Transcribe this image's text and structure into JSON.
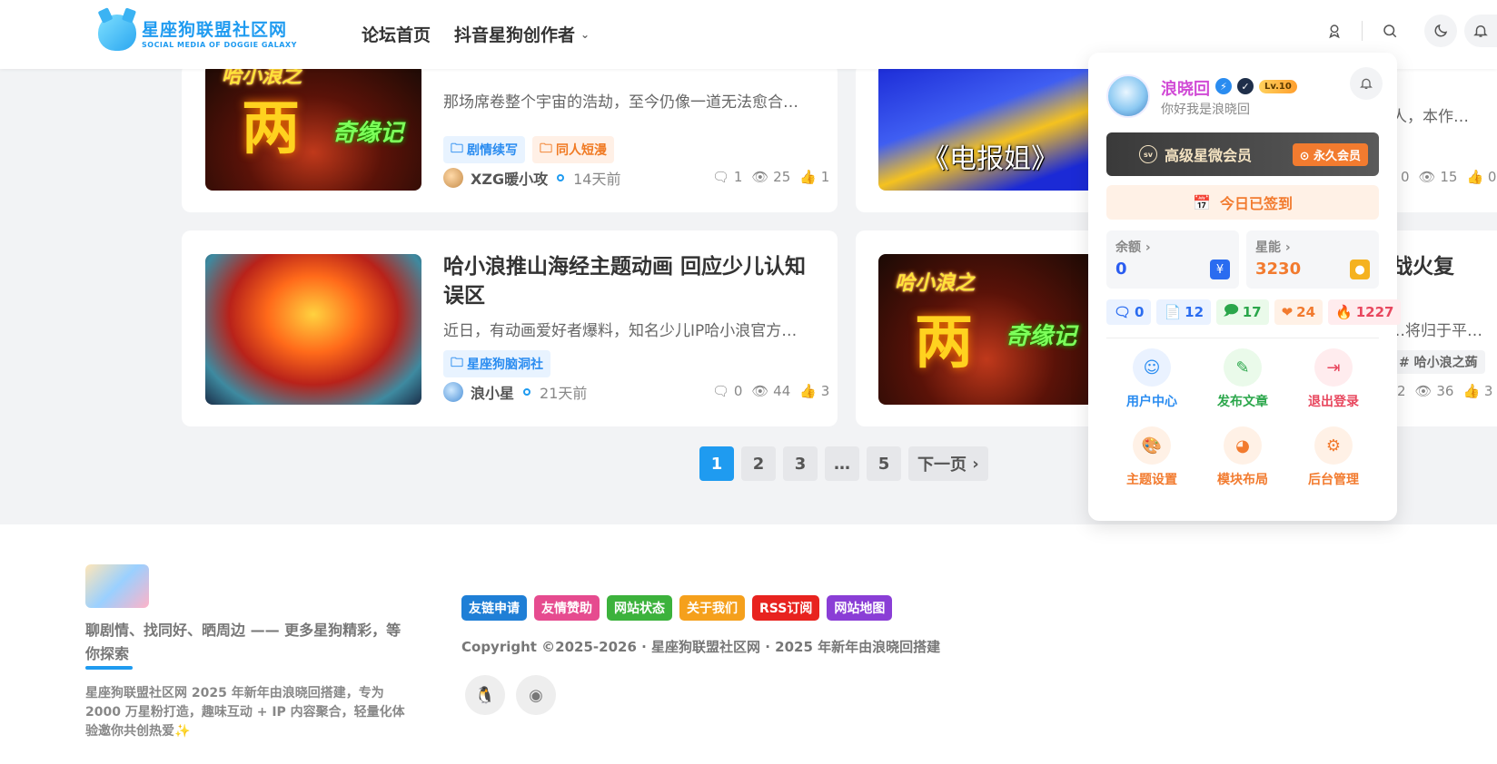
{
  "header": {
    "logo_title": "星座狗联盟社区网",
    "logo_sub": "SOCIAL MEDIA OF DOGGIE GALAXY",
    "nav": [
      {
        "label": "论坛首页"
      },
      {
        "label": "抖音星狗创作者"
      }
    ],
    "icons": [
      "user-icon",
      "search-icon",
      "moon-icon",
      "bell-icon"
    ]
  },
  "posts": [
    {
      "excerpt": "那场席卷整个宇宙的浩劫，至今仍像一道无法愈合…",
      "tags": [
        "剧情续写",
        "同人短漫"
      ],
      "author": "XZG暖小攻",
      "time": "14天前",
      "comments": "1",
      "views": "25",
      "likes": "1",
      "thumb_title": "哈小浪之",
      "thumb_big": "两",
      "thumb_side": "奇缘记"
    },
    {
      "thumb_caption": "《电报姐》",
      "excerpt": "人，本作品…",
      "comments": "0",
      "views": "15",
      "likes": "0"
    },
    {
      "title": "哈小浪推山海经主题动画 回应少儿认知误区",
      "excerpt": "近日，有动画爱好者爆料，知名少儿IP哈小浪官方…",
      "tags": [
        "星座狗脑洞社"
      ],
      "author": "浪小星",
      "time": "21天前",
      "comments": "0",
      "views": "44",
      "likes": "3"
    },
    {
      "title_tail": "战火复",
      "excerpt": "…将归于平…",
      "tag": "# 哈小浪之蒟",
      "comments": "2",
      "views": "36",
      "likes": "3",
      "thumb_title": "哈小浪之",
      "thumb_big": "两",
      "thumb_side": "奇缘记"
    }
  ],
  "pager": {
    "pages": [
      "1",
      "2",
      "3",
      "…",
      "5"
    ],
    "next": "下一页",
    "current": "1"
  },
  "user_panel": {
    "name": "浪晓回",
    "level": "Lv.10",
    "signature": "你好我是浪晓回",
    "vip_label": "高级星微会员",
    "vip_badge": "sv",
    "vip_tag": "永久会员",
    "checkin": "今日已签到",
    "balance_label": "余额",
    "balance_value": "0",
    "energy_label": "星能",
    "energy_value": "3230",
    "counts": [
      "0",
      "12",
      "17",
      "24",
      "1227"
    ],
    "menu": [
      {
        "label": "用户中心",
        "color": "#2a8cf0"
      },
      {
        "label": "发布文章",
        "color": "#2aa64a"
      },
      {
        "label": "退出登录",
        "color": "#e8475e"
      },
      {
        "label": "主题设置",
        "color": "#f27b2f"
      },
      {
        "label": "模块布局",
        "color": "#f27b2f"
      },
      {
        "label": "后台管理",
        "color": "#f27b2f"
      }
    ]
  },
  "footer": {
    "slogan": "聊剧情、找同好、晒周边 —— 更多星狗精彩，等你探索",
    "desc": "星座狗联盟社区网 2025 年新年由浪晓回搭建，专为 2000 万星粉打造，趣味互动 + IP 内容聚合，轻量化体验邀你共创热爱✨",
    "links": [
      {
        "label": "友链申请",
        "color": "#1f7fd6"
      },
      {
        "label": "友情赞助",
        "color": "#e64b8f"
      },
      {
        "label": "网站状态",
        "color": "#3cb23c"
      },
      {
        "label": "关于我们",
        "color": "#f5a01c"
      },
      {
        "label": "RSS订阅",
        "color": "#e8231f"
      },
      {
        "label": "网站地图",
        "color": "#8a3ed6"
      }
    ],
    "copyright": "Copyright ©2025-2026 · 星座狗联盟社区网 · 2025 年新年由浪晓回搭建"
  }
}
